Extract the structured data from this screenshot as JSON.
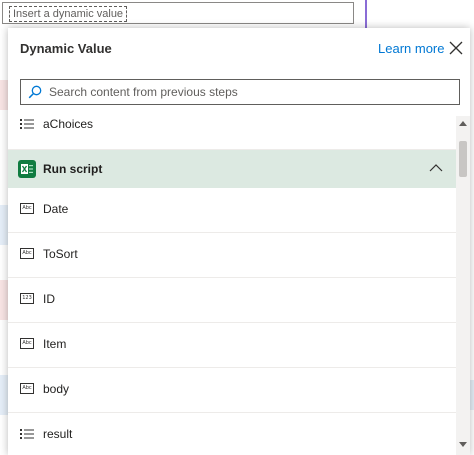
{
  "top_input": {
    "token_text": "Insert a dynamic value"
  },
  "panel": {
    "title": "Dynamic Value",
    "learn_more": "Learn more",
    "search": {
      "placeholder": "Search content from previous steps",
      "value": ""
    }
  },
  "list": {
    "partial_item": {
      "label": "aChoices",
      "icon": "list-icon"
    },
    "section": {
      "label": "Run script",
      "icon": "excel-icon",
      "expanded": true
    },
    "items": [
      {
        "label": "Date",
        "icon": "text-type-icon",
        "icon_text": "Abc"
      },
      {
        "label": "ToSort",
        "icon": "text-type-icon",
        "icon_text": "Abc"
      },
      {
        "label": "ID",
        "icon": "number-type-icon",
        "icon_text": "123"
      },
      {
        "label": "Item",
        "icon": "text-type-icon",
        "icon_text": "Abc"
      },
      {
        "label": "body",
        "icon": "text-type-icon",
        "icon_text": "Abc"
      },
      {
        "label": "result",
        "icon": "list-icon"
      }
    ]
  },
  "colors": {
    "accent": "#0078d4",
    "section_bg": "#dce9e1",
    "excel_green": "#107c41"
  }
}
